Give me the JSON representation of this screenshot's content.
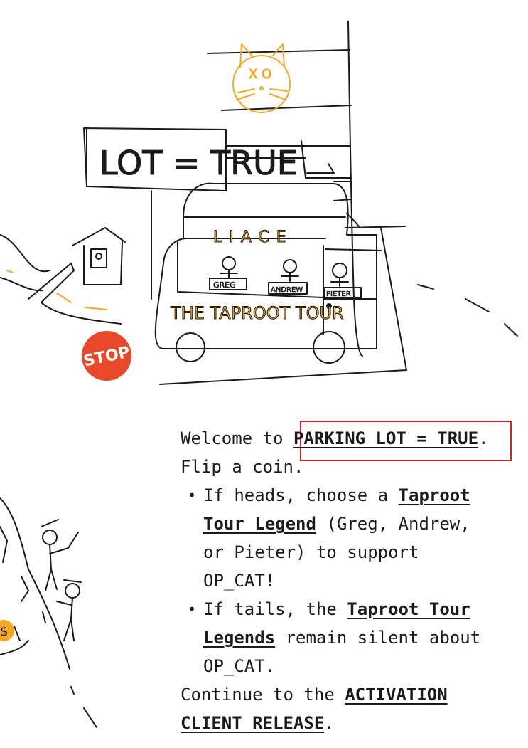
{
  "scene": {
    "sign_text": "LOT = TRUE",
    "bus_text": "THE TAPROOT TOUR",
    "bus_roof_text": "LIACE",
    "passengers": [
      "GREG",
      "ANDREW",
      "PIETER"
    ],
    "stop_sign": "STOP",
    "cat_eyes": "X O",
    "coin_symbol": "$",
    "colors": {
      "ink": "#1a1a1a",
      "orange": "#f5a623",
      "stop_red": "#e8492b",
      "highlight": "#e02020"
    }
  },
  "text": {
    "welcome_prefix": "Welcome to ",
    "parking_lot_link": "PARKING LOT = TRUE",
    "welcome_suffix": ".",
    "flip": "Flip a coin.",
    "heads_1": "If heads, choose a ",
    "heads_link_1": "Taproot",
    "heads_link_2": "Tour Legend",
    "heads_2": " (Greg, Andrew,",
    "heads_3": "or Pieter) to support",
    "heads_4": "OP_CAT!",
    "tails_1": "If tails, the ",
    "tails_link_1": "Taproot Tour",
    "tails_link_2": "Legends",
    "tails_2": " remain silent about",
    "tails_3": "OP_CAT.",
    "continue_1": "Continue to the ",
    "continue_link_1": "ACTIVATION",
    "continue_link_2": "CLIENT RELEASE",
    "continue_2": "."
  }
}
